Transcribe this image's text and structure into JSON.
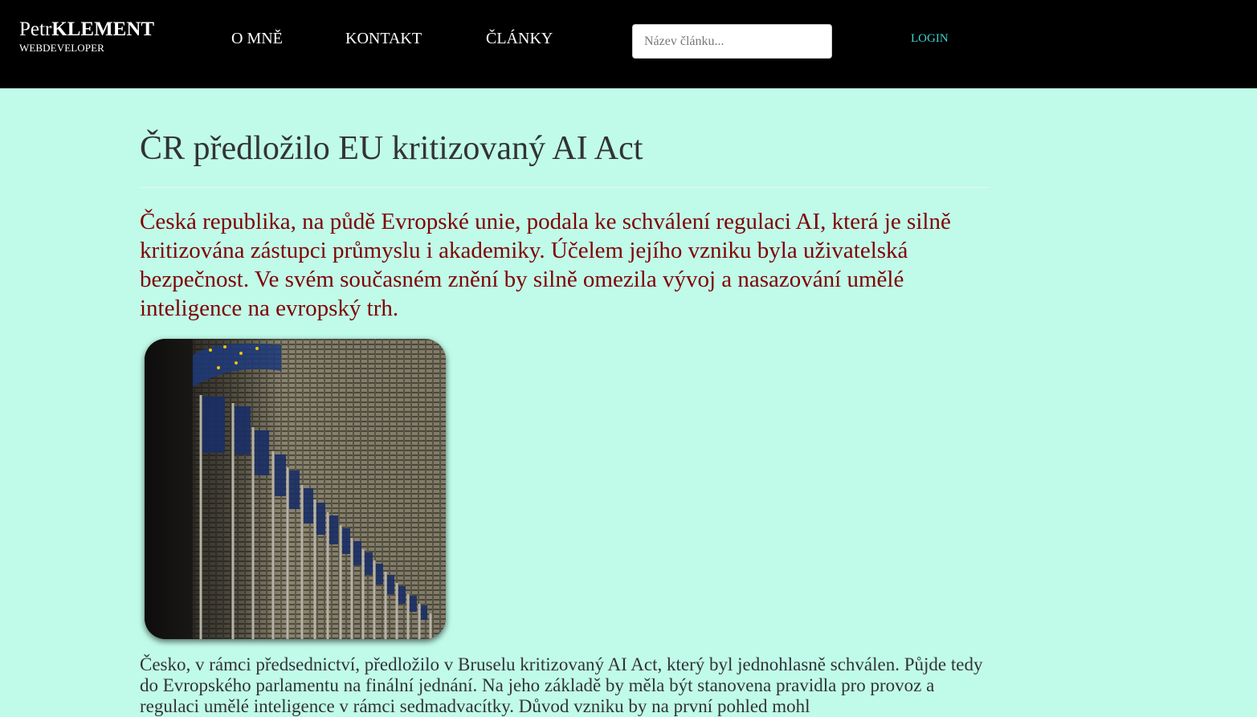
{
  "header": {
    "brand_first": "Petr",
    "brand_last": "KLEMENT",
    "brand_subtitle": "WEBDEVELOPER",
    "nav": [
      "O MNĚ",
      "KONTAKT",
      "ČLÁNKY"
    ],
    "search_placeholder": "Název článku...",
    "login_label": "LOGIN"
  },
  "article": {
    "title": "ČR předložilo EU kritizovaný AI Act",
    "lead": "Česká republika, na půdě Evropské unie, podala ke schválení regulaci AI, která je silně kritizována zástupci průmyslu i akademiky. Účelem jejího vzniku byla uživatelská bezpečnost. Ve svém současném znění by silně omezila vývoj a nasazování umělé inteligence na evropský trh.",
    "image": "eu-flags-building-photo",
    "body": "Česko, v rámci předsednictví, předložilo v Bruselu kritizovaný AI Act, který byl jednohlasně schválen. Půjde tedy do Evropského parlamentu na finální jednání. Na jeho základě by měla být stanovena pravidla pro provoz a regulaci umělé inteligence v rámci sedmadvacítky. Důvod vzniku by na první pohled mohl"
  },
  "colors": {
    "background": "#c0fbe9",
    "header": "#000000",
    "lead_text": "#800000",
    "login": "#3fd3cf"
  }
}
